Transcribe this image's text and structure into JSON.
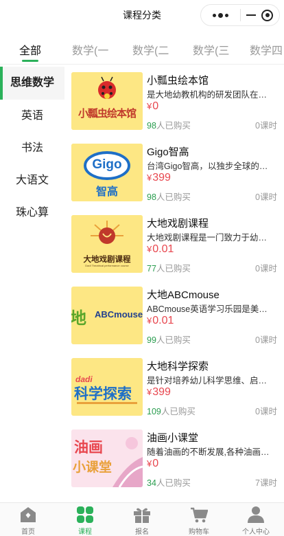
{
  "nav": {
    "title": "课程分类"
  },
  "tabs": [
    {
      "label": "全部"
    },
    {
      "label": "数学(一"
    },
    {
      "label": "数学(二"
    },
    {
      "label": "数学(三"
    },
    {
      "label": "数学四"
    }
  ],
  "sidebar": {
    "items": [
      {
        "label": "思维数学"
      },
      {
        "label": "英语"
      },
      {
        "label": "书法"
      },
      {
        "label": "大语文"
      },
      {
        "label": "珠心算"
      }
    ]
  },
  "currency": "¥",
  "courses": [
    {
      "title": "小瓢虫绘本馆",
      "desc": "是大地幼教机构的研发团队在…",
      "price": "0",
      "buyers": "98",
      "buyers_suffix": "人已购买",
      "lessons": "0课时",
      "thumb_text": "小瓢虫绘本馆"
    },
    {
      "title": "Gigo智高",
      "desc": "台湾Gigo智高，以独步全球的…",
      "price": "399",
      "buyers": "98",
      "buyers_suffix": "人已购买",
      "lessons": "0课时",
      "thumb_text": "Gigo",
      "thumb_sub": "智高"
    },
    {
      "title": "大地戏剧课程",
      "desc": "大地戏剧课程是一门致力于幼…",
      "price": "0.01",
      "buyers": "77",
      "buyers_suffix": "人已购买",
      "lessons": "0课时",
      "thumb_text": "大地戏剧课程",
      "thumb_sub": "Dadi Theatrical performance course"
    },
    {
      "title": "大地ABCmouse",
      "desc": "ABCmouse英语学习乐园是美…",
      "price": "0.01",
      "buyers": "99",
      "buyers_suffix": "人已购买",
      "lessons": "0课时",
      "thumb_text": "ABCmouse",
      "thumb_sub": "地"
    },
    {
      "title": "大地科学探索",
      "desc": "是针对培养幼儿科学思维、启…",
      "price": "399",
      "buyers": "109",
      "buyers_suffix": "人已购买",
      "lessons": "0课时",
      "thumb_text": "科学探索",
      "thumb_sub": "dadi"
    },
    {
      "title": "油画小课堂",
      "desc": "随着油画的不断发展,各种油画…",
      "price": "0",
      "buyers": "34",
      "buyers_suffix": "人已购买",
      "lessons": "7课时",
      "thumb_text": "油画",
      "thumb_sub": "小课堂"
    }
  ],
  "tabbar": [
    {
      "label": "首页",
      "icon": "home-icon"
    },
    {
      "label": "课程",
      "icon": "grid-icon"
    },
    {
      "label": "报名",
      "icon": "gift-icon"
    },
    {
      "label": "购物车",
      "icon": "cart-icon"
    },
    {
      "label": "个人中心",
      "icon": "user-icon"
    }
  ],
  "colors": {
    "accent": "#2bb15a",
    "price": "#e8474f",
    "buyers": "#2a9d4f"
  }
}
